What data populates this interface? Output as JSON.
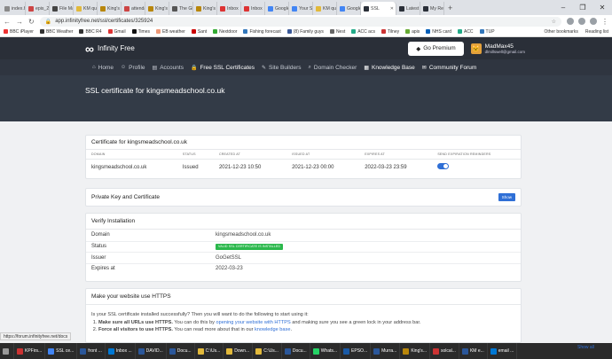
{
  "browser": {
    "tabs": [
      {
        "label": "index.h",
        "color": "#8a8a8a"
      },
      {
        "label": "epis_2(",
        "color": "#c44"
      },
      {
        "label": "File Ma",
        "color": "#444"
      },
      {
        "label": "KM qu",
        "color": "#e2b93b"
      },
      {
        "label": "King's",
        "color": "#b8860b"
      },
      {
        "label": "attenda",
        "color": "#c44"
      },
      {
        "label": "King's",
        "color": "#b8860b"
      },
      {
        "label": "The Gi",
        "color": "#555"
      },
      {
        "label": "King's",
        "color": "#b8860b"
      },
      {
        "label": "Inbox",
        "color": "#d33"
      },
      {
        "label": "Inbox",
        "color": "#d33"
      },
      {
        "label": "Google",
        "color": "#4285f4"
      },
      {
        "label": "Your S",
        "color": "#4285f4"
      },
      {
        "label": "KM qu",
        "color": "#e2b93b"
      },
      {
        "label": "Google",
        "color": "#4285f4"
      },
      {
        "label": "SSL",
        "color": "#2a2f38",
        "active": true
      },
      {
        "label": "Latest",
        "color": "#2a2f38"
      },
      {
        "label": "My Re",
        "color": "#2a2f38"
      }
    ],
    "new_tab": "+",
    "window_controls": [
      "–",
      "❐",
      "✕"
    ],
    "url": "app.infinityfree.net/ssl/certificates/325924",
    "bookmarks": [
      {
        "label": "BBC iPlayer",
        "color": "#e33"
      },
      {
        "label": "BBC Weather",
        "color": "#333"
      },
      {
        "label": "BBC R4",
        "color": "#333"
      },
      {
        "label": "Gmail",
        "color": "#d33"
      },
      {
        "label": "Times",
        "color": "#111"
      },
      {
        "label": "EB weather",
        "color": "#e97"
      },
      {
        "label": "Sant",
        "color": "#c00"
      },
      {
        "label": "Nextdoor",
        "color": "#3a3"
      },
      {
        "label": "Fishing forecast",
        "color": "#37b"
      },
      {
        "label": "(8) Family guys",
        "color": "#3b5998"
      },
      {
        "label": "Nest",
        "color": "#666"
      },
      {
        "label": "ACC acs",
        "color": "#2a8"
      },
      {
        "label": "Tilney",
        "color": "#c33"
      },
      {
        "label": "apis",
        "color": "#6a3"
      },
      {
        "label": "NHS card",
        "color": "#005eb8"
      },
      {
        "label": "ACC",
        "color": "#2a8"
      },
      {
        "label": "TUP",
        "color": "#37b"
      }
    ],
    "bookmarks_right": [
      "Other bookmarks",
      "Reading list"
    ]
  },
  "header": {
    "brand": "Infinity Free",
    "premium_button": "Go Premium",
    "user_name": "MadMax45",
    "user_email": "dlmillswell@gmail.com"
  },
  "menu": [
    {
      "label": "Home",
      "icon": "⌂"
    },
    {
      "label": "Profile",
      "icon": "☺"
    },
    {
      "label": "Accounts",
      "icon": "▤"
    },
    {
      "label": "Free SSL Certificates",
      "icon": "🔒",
      "active": true
    },
    {
      "label": "Site Builders",
      "icon": "✎"
    },
    {
      "label": "Domain Checker",
      "icon": "⌕"
    },
    {
      "label": "Knowledge Base",
      "icon": "▦",
      "lit": true
    },
    {
      "label": "Community Forum",
      "icon": "✉",
      "lit": true
    }
  ],
  "page_title": "SSL certificate for kingsmeadschool.co.uk",
  "certificate": {
    "title": "Certificate for kingsmeadschool.co.uk",
    "columns": [
      "DOMAIN",
      "STATUS",
      "CREATED AT",
      "ISSUED AT",
      "EXPIRES AT",
      "SEND EXPIRATION REMINDERS"
    ],
    "row": [
      "kingsmeadschool.co.uk",
      "Issued",
      "2021-12-23 10:50",
      "2021-12-23 00:00",
      "2022-03-23 23:59"
    ],
    "reminders_on": true
  },
  "private_key": {
    "title": "Private Key and Certificate",
    "show_button": "Show"
  },
  "verify": {
    "title": "Verify Installation",
    "domain_label": "Domain",
    "domain_value": "kingsmeadschool.co.uk",
    "status_label": "Status",
    "status_badge": "VALID SSL CERTIFICATE IS INSTALLED",
    "issuer_label": "Issuer",
    "issuer_value": "GoGetSSL",
    "expires_label": "Expires at",
    "expires_value": "2022-03-23"
  },
  "https": {
    "title": "Make your website use HTTPS",
    "intro": "Is your SSL certificate installed successfully? Then you will want to do the following to start using it:",
    "step1_bold": "Make sure all URLs use HTTPS.",
    "step1_text": " You can do this by ",
    "step1_link": "opening your website with HTTPS",
    "step1_tail": " and making sure you see a green lock in your address bar.",
    "step2_bold": "Force all visitors to use HTTPS.",
    "step2_text": " You can read more about that in our ",
    "step2_link": "knowledge base",
    "step2_tail": "."
  },
  "status_url": "https://forum.infinityfree.net/docs",
  "taskbar": [
    {
      "label": "",
      "color": "#999"
    },
    {
      "label": "KPFirs...",
      "color": "#c33"
    },
    {
      "label": "SSL ce...",
      "color": "#4285f4"
    },
    {
      "label": "front ...",
      "color": "#2b579a"
    },
    {
      "label": "Inbox ...",
      "color": "#0078d4"
    },
    {
      "label": "DAVID...",
      "color": "#2b579a"
    },
    {
      "label": "Docu...",
      "color": "#2b579a"
    },
    {
      "label": "C:\\Us...",
      "color": "#e2b93b"
    },
    {
      "label": "Down...",
      "color": "#e2b93b"
    },
    {
      "label": "C:\\Us...",
      "color": "#e2b93b"
    },
    {
      "label": "Docu...",
      "color": "#2b579a"
    },
    {
      "label": "Whats...",
      "color": "#25d366"
    },
    {
      "label": "EPSO...",
      "color": "#1a5aa6"
    },
    {
      "label": "Murra...",
      "color": "#2b579a"
    },
    {
      "label": "King's...",
      "color": "#b8860b"
    },
    {
      "label": "solcal...",
      "color": "#c33"
    },
    {
      "label": "KM e...",
      "color": "#2b579a"
    },
    {
      "label": "email ...",
      "color": "#0078d4"
    }
  ],
  "show_all": "Show all"
}
